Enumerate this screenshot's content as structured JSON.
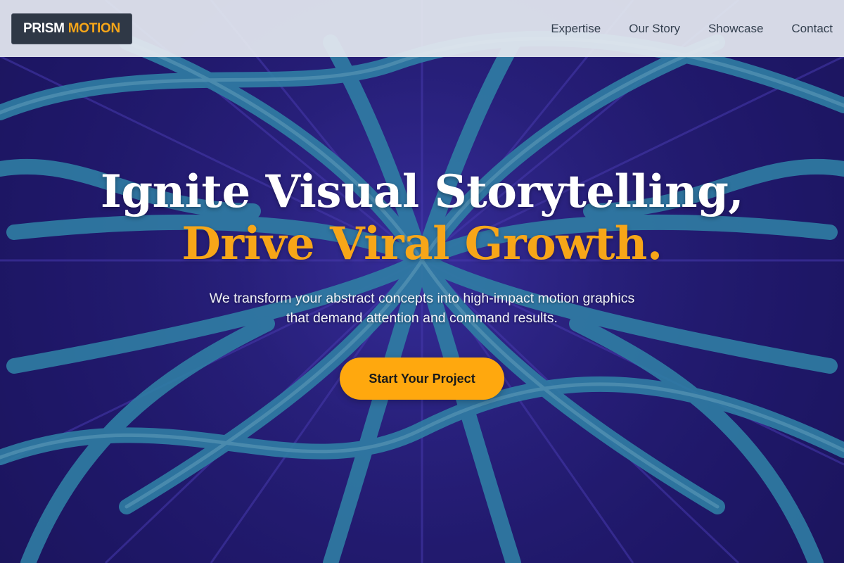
{
  "brand": {
    "name_part1": "PRISM",
    "name_part2": "MOTION",
    "accent_color": "#f7a618"
  },
  "nav": {
    "items": [
      {
        "label": "Expertise"
      },
      {
        "label": "Our Story"
      },
      {
        "label": "Showcase"
      },
      {
        "label": "Contact"
      }
    ]
  },
  "hero": {
    "headline_line1": "Ignite Visual Storytelling,",
    "headline_line2": "Drive Viral Growth.",
    "subtext_line1": "We transform your abstract concepts into high-impact motion graphics",
    "subtext_line2": "that demand attention and command results.",
    "cta_label": "Start Your Project",
    "background_description_colors": [
      "#2d1f8e",
      "#3a9ec4"
    ]
  }
}
